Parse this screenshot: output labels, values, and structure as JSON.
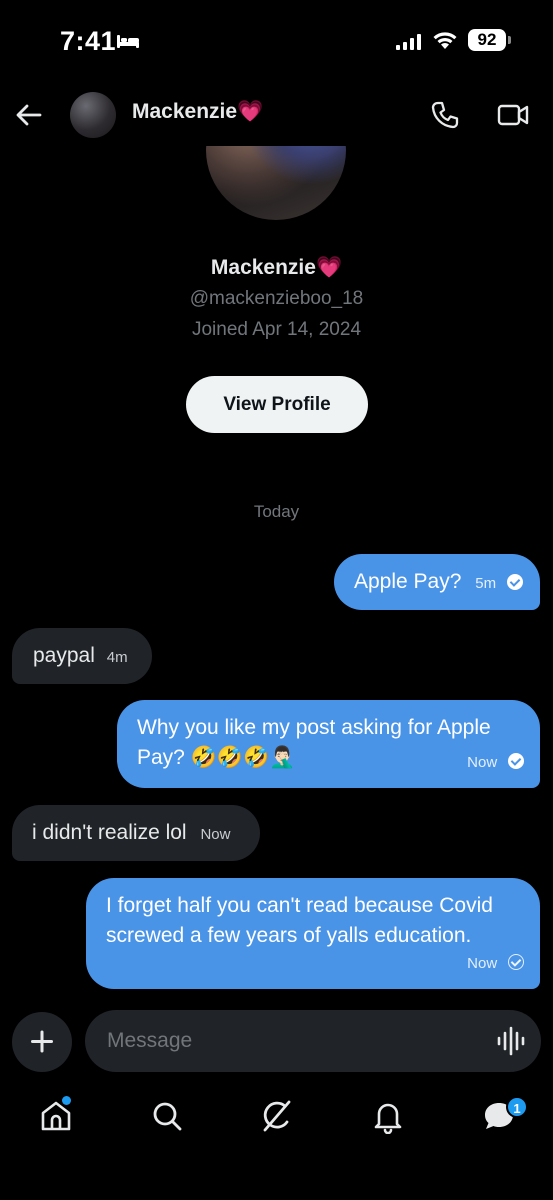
{
  "status_bar": {
    "time": "7:41",
    "battery": "92"
  },
  "header": {
    "name": "Mackenzie💗"
  },
  "profile": {
    "name": "Mackenzie💗",
    "handle": "@mackenzieboo_18",
    "joined": "Joined Apr 14, 2024",
    "view_button": "View Profile"
  },
  "date_divider": "Today",
  "messages": [
    {
      "direction": "sent",
      "text": "Apple Pay?",
      "time": "5m"
    },
    {
      "direction": "received",
      "text": "paypal",
      "time": "4m"
    },
    {
      "direction": "sent",
      "text_line1": "Why you like my post asking for Apple",
      "text_line2": "Pay? 🤣🤣🤣🤦🏻‍♂️",
      "time": "Now"
    },
    {
      "direction": "received",
      "text": "i didn't realize lol",
      "time": "Now"
    },
    {
      "direction": "sent",
      "text_line1": "I forget half you can't read because Covid",
      "text_line2": "screwed a few years of yalls education.",
      "time": "Now"
    }
  ],
  "composer": {
    "placeholder": "Message"
  },
  "tab_bar": {
    "messages_badge": "1"
  },
  "colors": {
    "sent_bubble": "#4a94e8",
    "received_bubble": "#202327",
    "accent": "#1d9bf0"
  },
  "icons": [
    "bed-icon",
    "signal-icon",
    "wifi-icon",
    "back-arrow-icon",
    "phone-icon",
    "video-icon",
    "plus-icon",
    "voice-icon",
    "home-icon",
    "search-icon",
    "grok-icon",
    "bell-icon",
    "messages-icon"
  ]
}
